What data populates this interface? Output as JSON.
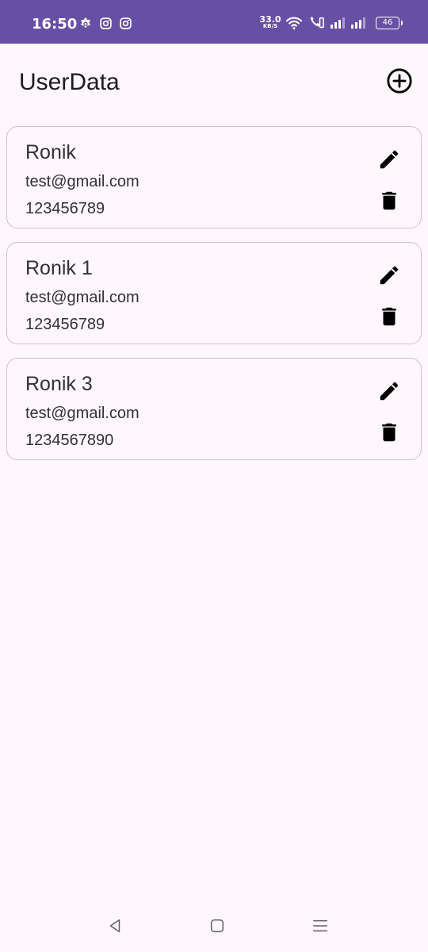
{
  "status_bar": {
    "time": "16:50",
    "net_speed_value": "33.0",
    "net_speed_unit": "KB/S",
    "battery": "46"
  },
  "header": {
    "title": "UserData"
  },
  "users": [
    {
      "name": "Ronik",
      "email": "test@gmail.com",
      "phone": "123456789"
    },
    {
      "name": "Ronik 1",
      "email": "test@gmail.com",
      "phone": "123456789"
    },
    {
      "name": "Ronik 3",
      "email": "test@gmail.com",
      "phone": "1234567890"
    }
  ],
  "colors": {
    "status_bar": "#6750a4",
    "background": "#fef7fc",
    "card_border": "#c9c3cb",
    "text": "#333038"
  },
  "icons": {
    "add": "add-circle-outline-icon",
    "edit": "pencil-icon",
    "delete": "trash-icon",
    "nav_back": "triangle-back-icon",
    "nav_home": "rounded-square-home-icon",
    "nav_recents": "three-lines-menu-icon"
  }
}
